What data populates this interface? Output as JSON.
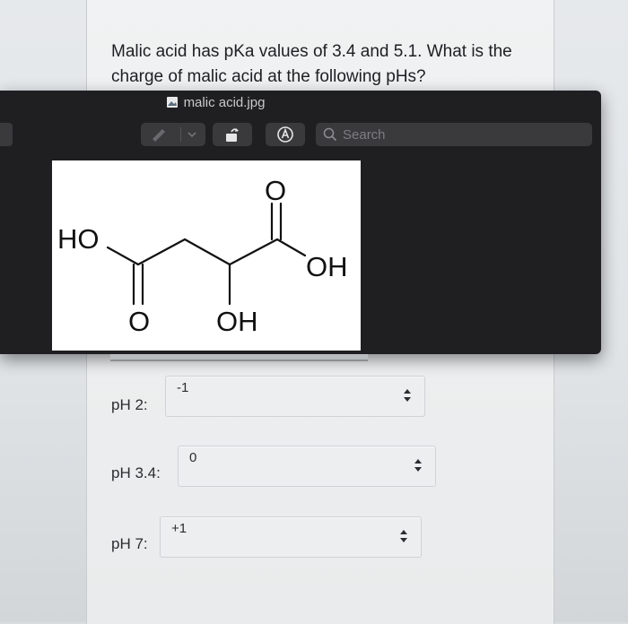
{
  "question": {
    "text": "Malic acid has pKa values of 3.4 and 5.1. What is the charge of malic acid at the following pHs?"
  },
  "viewer": {
    "file_name": "malic acid.jpg",
    "search_placeholder": "Search",
    "structure_labels": {
      "ho_left": "HO",
      "oh_right": "OH",
      "o_top": "O",
      "o_bottom": "O",
      "oh_bottom": "OH"
    }
  },
  "answers": [
    {
      "label": "pH 2:",
      "value": "-1"
    },
    {
      "label": "pH 3.4:",
      "value": "0"
    },
    {
      "label": "pH 7:",
      "value": "+1"
    }
  ],
  "icons": {
    "file": "image-file-icon",
    "pen": "pen-icon",
    "rotate": "rotate-icon",
    "markup": "markup-icon",
    "search": "search-icon",
    "select_arrows": "updown-arrows-icon"
  }
}
